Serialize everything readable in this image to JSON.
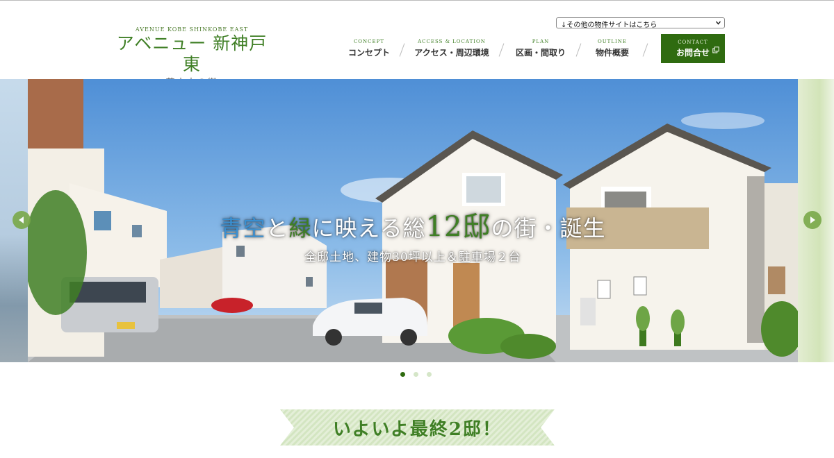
{
  "header": {
    "logo": {
      "subtitle": "AVENUE KOBE SHINKOBE EAST",
      "name": "アベニュー 新神戸東",
      "tagline": "~花水木の街~"
    },
    "site_select": {
      "selected": "↓その他の物件サイトはこちら"
    },
    "nav": [
      {
        "en": "CONCEPT",
        "ja": "コンセプト"
      },
      {
        "en": "ACCESS & LOCATION",
        "ja": "アクセス・周辺環境"
      },
      {
        "en": "PLAN",
        "ja": "区画・間取り"
      },
      {
        "en": "OUTLINE",
        "ja": "物件概要"
      }
    ],
    "contact": {
      "en": "CONTACT",
      "ja": "お問合せ"
    }
  },
  "hero": {
    "caption": {
      "part1": "青空",
      "part2": "と",
      "part3": "緑",
      "part4": "に映える総",
      "part5": "12邸",
      "part6": "の街・誕生",
      "line2": "全邸土地、建物30坪以上＆駐車場２台"
    },
    "slide_count": 3,
    "active_slide": 0
  },
  "headline": {
    "text": "いよいよ最終2邸！"
  },
  "colors": {
    "brand_green": "#3f7f25",
    "contact_bg": "#2f6b10",
    "caption_blue": "#3a8fd0",
    "arrow_green": "#7aa94a"
  },
  "icons": {
    "select": "chevron-down-icon",
    "contact": "external-link-icon",
    "prev": "arrow-left-icon",
    "next": "arrow-right-icon"
  }
}
